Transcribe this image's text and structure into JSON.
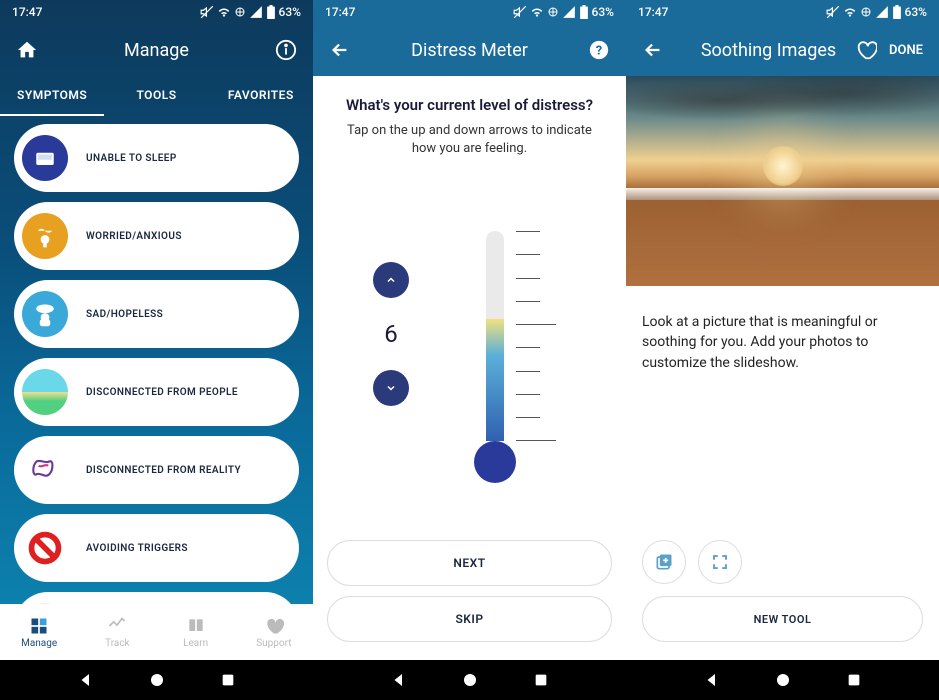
{
  "status": {
    "time": "17:47",
    "battery": "63%"
  },
  "screen1": {
    "title": "Manage",
    "tabs": [
      "SYMPTOMS",
      "TOOLS",
      "FAVORITES"
    ],
    "activeTab": 0,
    "symptoms": [
      {
        "label": "UNABLE TO SLEEP",
        "iconBg": "#2a3a9a",
        "icon": "sleep"
      },
      {
        "label": "WORRIED/ANXIOUS",
        "iconBg": "#e8a020",
        "icon": "anxious"
      },
      {
        "label": "SAD/HOPELESS",
        "iconBg": "#3aa8d8",
        "icon": "sad"
      },
      {
        "label": "DISCONNECTED FROM PEOPLE",
        "iconBg": "#6ad8e8",
        "icon": "beach"
      },
      {
        "label": "DISCONNECTED FROM REALITY",
        "iconBg": "#fff",
        "icon": "abstract"
      },
      {
        "label": "AVOIDING TRIGGERS",
        "iconBg": "#fff",
        "icon": "no"
      }
    ],
    "nav": [
      {
        "label": "Manage",
        "active": true
      },
      {
        "label": "Track",
        "active": false
      },
      {
        "label": "Learn",
        "active": false
      },
      {
        "label": "Support",
        "active": false
      }
    ]
  },
  "screen2": {
    "title": "Distress Meter",
    "question": "What's your current level of distress?",
    "instruction": "Tap on the up and down arrows to indicate how you are feeling.",
    "level": "6",
    "nextLabel": "NEXT",
    "skipLabel": "SKIP"
  },
  "screen3": {
    "title": "Soothing Images",
    "doneLabel": "DONE",
    "description": "Look at a picture that is meaningful or soothing for you. Add your photos to customize the slideshow.",
    "newToolLabel": "NEW TOOL"
  }
}
